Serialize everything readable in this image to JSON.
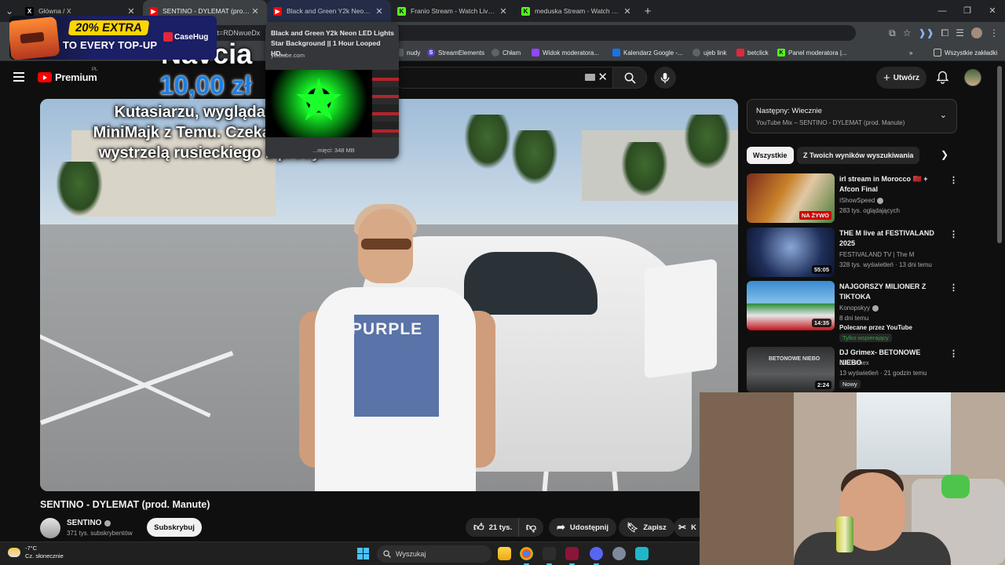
{
  "browser": {
    "tabs": [
      {
        "title": "Główna / X",
        "favicon": "x-logo-icon",
        "color": "#000000"
      },
      {
        "title": "SENTINO - DYLEMAT (prod. Ma",
        "favicon": "youtube-icon",
        "color": "#ff0000"
      },
      {
        "title": "Black and Green Y2k Neon LED",
        "favicon": "youtube-icon",
        "color": "#ff0000"
      },
      {
        "title": "Franio Stream - Watch Live on",
        "favicon": "kick-icon",
        "color": "#53fc18"
      },
      {
        "title": "meduska Stream - Watch Live o",
        "favicon": "kick-icon",
        "color": "#53fc18"
      }
    ],
    "address_fragment": "st=RDNwueDx",
    "bookmarks": [
      {
        "label": "nudy",
        "icon": "folder-icon"
      },
      {
        "label": "StreamElements",
        "icon": "streamelements-icon"
      },
      {
        "label": "Chłam",
        "icon": "globe-icon"
      },
      {
        "label": "Widok moderatora...",
        "icon": "twitch-icon"
      },
      {
        "label": "Kalendarz Google -...",
        "icon": "calendar-icon"
      },
      {
        "label": "ujeb link",
        "icon": "globe-icon"
      },
      {
        "label": "betclick",
        "icon": "betclic-icon"
      },
      {
        "label": "Panel moderatora |...",
        "icon": "kick-icon"
      }
    ],
    "bookmarks_more": "»",
    "all_bookmarks": "Wszystkie zakładki"
  },
  "tab_preview": {
    "title": "Black and Green Y2k Neon LED Lights Star Background || 1 Hour Looped HD...",
    "domain": "youtube.com",
    "memory": "...mięci: 348 MB"
  },
  "ad": {
    "badge": "20% EXTRA",
    "line2": "TO EVERY TOP-UP",
    "brand": "CaseHug"
  },
  "donation": {
    "name": "Navcia",
    "amount": "10,00 zł",
    "message": "Kutasiarzu, wyglądasz jak MiniMajk z Temu. Czekam kiedy wystrzelą rusieckiego z procy."
  },
  "youtube": {
    "logo": "Premium",
    "country": "PL",
    "create": "Utwórz",
    "video": {
      "title": "SENTINO - DYLEMAT (prod. Manute)",
      "shirt_text": "PURPLE"
    },
    "channel": {
      "name": "SENTINO",
      "subs": "371 tys. subskrybentów",
      "subscribe": "Subskrybuj"
    },
    "actions": {
      "likes": "21 tys.",
      "share": "Udostępnij",
      "save": "Zapisz",
      "clip": "K"
    },
    "playlist": {
      "next": "Następny: Wiecznie",
      "sub": "YouTube Mix – SENTINO - DYLEMAT (prod. Manute)"
    },
    "chips": [
      "Wszystkie",
      "Z Twoich wyników wyszukiwania"
    ],
    "recommendations": [
      {
        "title": "irl stream in Morocco 🇲🇦 + Afcon Final",
        "channel": "IShowSpeed",
        "meta": "283 tys. oglądających",
        "badge": "NA ŻYWO"
      },
      {
        "title": "THE M live at FESTIVALAND 2025",
        "channel": "FESTIVALAND TV | The M",
        "meta": "328 tys. wyświetleń · 13 dni temu",
        "duration": "55:05"
      },
      {
        "title": "NAJGORSZY MILIONER Z TIKTOKA",
        "channel": "Konopskyy",
        "meta": "8 dni temu",
        "tag": "Polecane przez YouTube",
        "support": "Tylko wspierający",
        "duration": "14:35"
      },
      {
        "title": "DJ Grimex- BETONOWE NIEBO",
        "channel": "DJ Grimex",
        "meta": "13 wyświetleń · 21 godzin temu",
        "new": "Nowy",
        "duration": "2:24",
        "thumb_text": "BETONOWE NIEBO"
      }
    ]
  },
  "taskbar": {
    "temp": "-7°C",
    "weather": "Cz. słonecznie",
    "search": "Wyszukaj"
  }
}
